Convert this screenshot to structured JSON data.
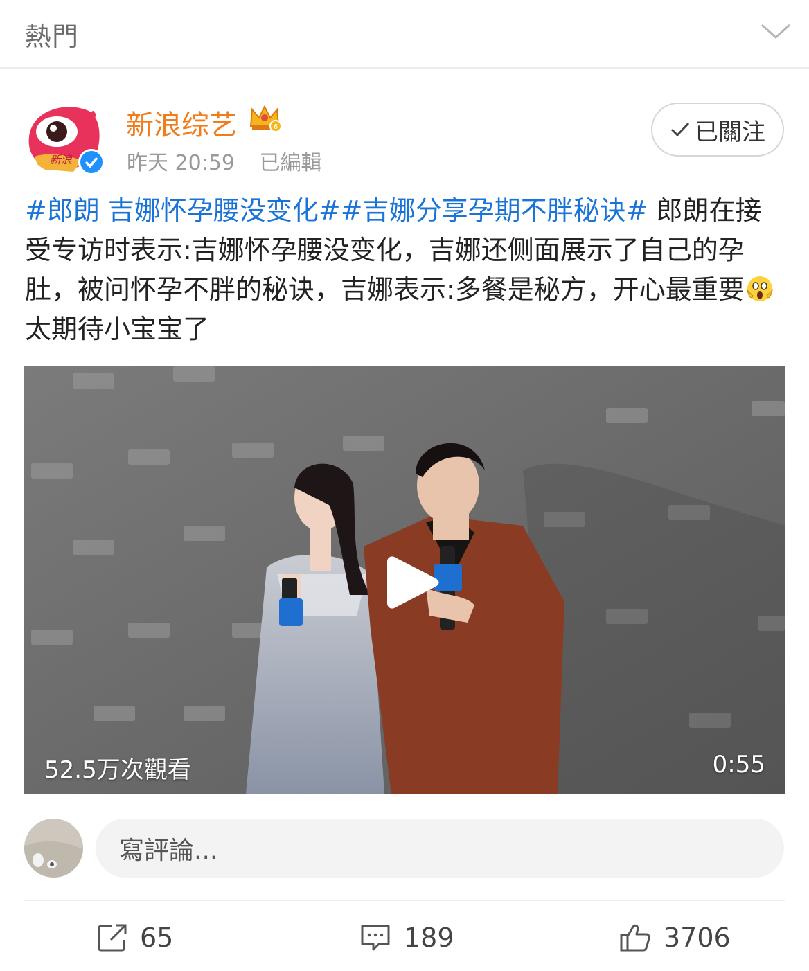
{
  "header": {
    "title": "熱門"
  },
  "post": {
    "author": "新浪综艺",
    "time": "昨天 20:59",
    "edited": "已編輯",
    "follow_label": "已關注",
    "avatar_text": "新浪",
    "hashtags": [
      "#郎朗 吉娜怀孕腰没变化#",
      "#吉娜分享孕期不胖秘诀#"
    ],
    "text_part1": " 郎朗在接受专访时表示:吉娜怀孕腰没变化，吉娜还侧面展示了自己的孕肚，被问怀孕不胖的秘诀，吉娜表示:多餐是秘方，开心最重要",
    "text_part2": "太期待小宝宝了"
  },
  "video": {
    "views": "52.5万次觀看",
    "duration": "0:55"
  },
  "comment_box": {
    "placeholder": "寫評論..."
  },
  "actions": {
    "repost_count": "65",
    "comment_count": "189",
    "like_count": "3706"
  },
  "colors": {
    "author": "#f07c1c",
    "hashtag": "#1a74d8",
    "verified": "#1e90ff"
  },
  "icons": [
    "chevron-down-icon",
    "crown-badge-icon",
    "verified-icon",
    "check-icon",
    "scream-emoji-icon",
    "play-icon",
    "repost-icon",
    "comment-icon",
    "thumbs-up-icon"
  ]
}
